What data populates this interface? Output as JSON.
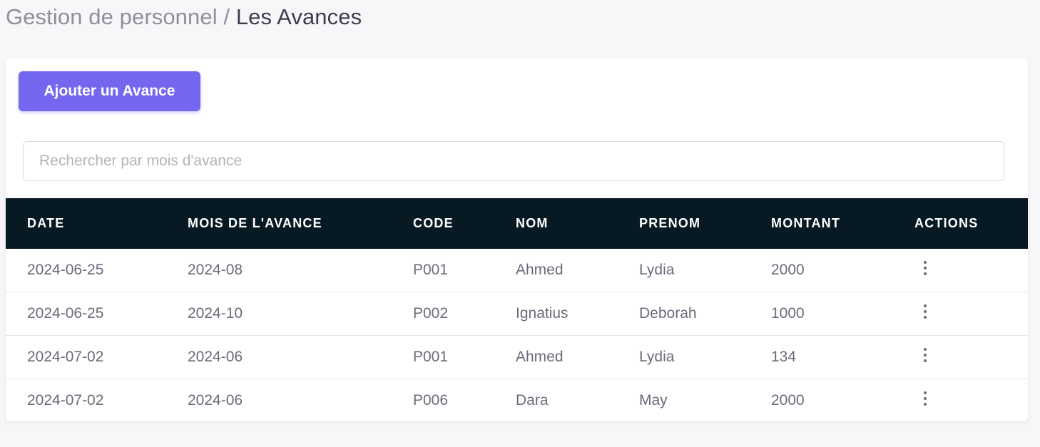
{
  "breadcrumb": {
    "parent": "Gestion de personnel",
    "separator": " / ",
    "current": "Les Avances"
  },
  "toolbar": {
    "add_label": "Ajouter un Avance"
  },
  "search": {
    "placeholder": "Rechercher par mois d'avance",
    "value": ""
  },
  "table": {
    "headers": [
      "DATE",
      "MOIS DE L'AVANCE",
      "CODE",
      "NOM",
      "PRENOM",
      "MONTANT",
      "ACTIONS"
    ],
    "rows": [
      [
        "2024-06-25",
        "2024-08",
        "P001",
        "Ahmed",
        "Lydia",
        "2000"
      ],
      [
        "2024-06-25",
        "2024-10",
        "P002",
        "Ignatius",
        "Deborah",
        "1000"
      ],
      [
        "2024-07-02",
        "2024-06",
        "P001",
        "Ahmed",
        "Lydia",
        "134"
      ],
      [
        "2024-07-02",
        "2024-06",
        "P006",
        "Dara",
        "May",
        "2000"
      ]
    ],
    "row_action_icon": "more-vertical-icon"
  },
  "colors": {
    "primary": "#7367f0",
    "table_header_bg": "#071a23",
    "page_bg": "#f7f7f9"
  }
}
